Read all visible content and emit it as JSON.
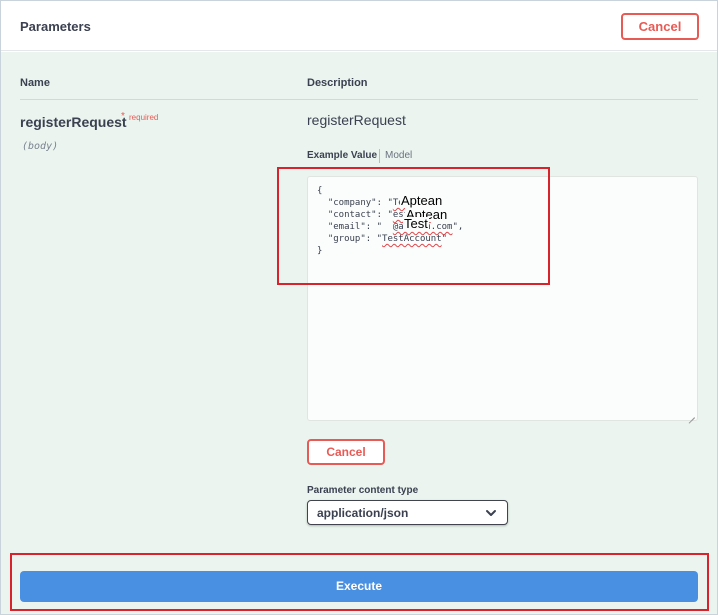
{
  "header": {
    "title": "Parameters",
    "cancel_label": "Cancel"
  },
  "columns": {
    "name": "Name",
    "description": "Description"
  },
  "param": {
    "name": "registerRequest",
    "required_star": "*",
    "required_label": "required",
    "location": "(body)",
    "description": "registerRequest"
  },
  "tabs": {
    "example_value": "Example Value",
    "model": "Model"
  },
  "json_editor": {
    "open_brace": "{",
    "company_key": "  \"company\": \"",
    "company_tail": "Test",
    "company_end": "\",",
    "contact_key": "  \"contact\": \"",
    "contact_tail": "estUser",
    "contact_end": "\",",
    "email_key": "  \"email\": \"  ",
    "email_tail": "@aptean.com",
    "email_end": "\",",
    "group_key": "  \"group\": \"",
    "group_value": "TestAccount",
    "group_end": "\"",
    "close_brace": "}"
  },
  "overlays": {
    "company_word": "Aptean",
    "contact_word": "Aptean",
    "email_word": "Test"
  },
  "cancel_mid_label": "Cancel",
  "content_type": {
    "label": "Parameter content type",
    "selected": "application/json"
  },
  "execute_label": "Execute",
  "colors": {
    "cancel_red": "#e85b55",
    "execute_blue": "#4990e2",
    "panel_bg": "#ebf4ee",
    "annotation_red": "#d8232a"
  },
  "icons": {
    "select_chevron": "chevron-down-icon",
    "resize_handle": "resize-grip-icon"
  }
}
